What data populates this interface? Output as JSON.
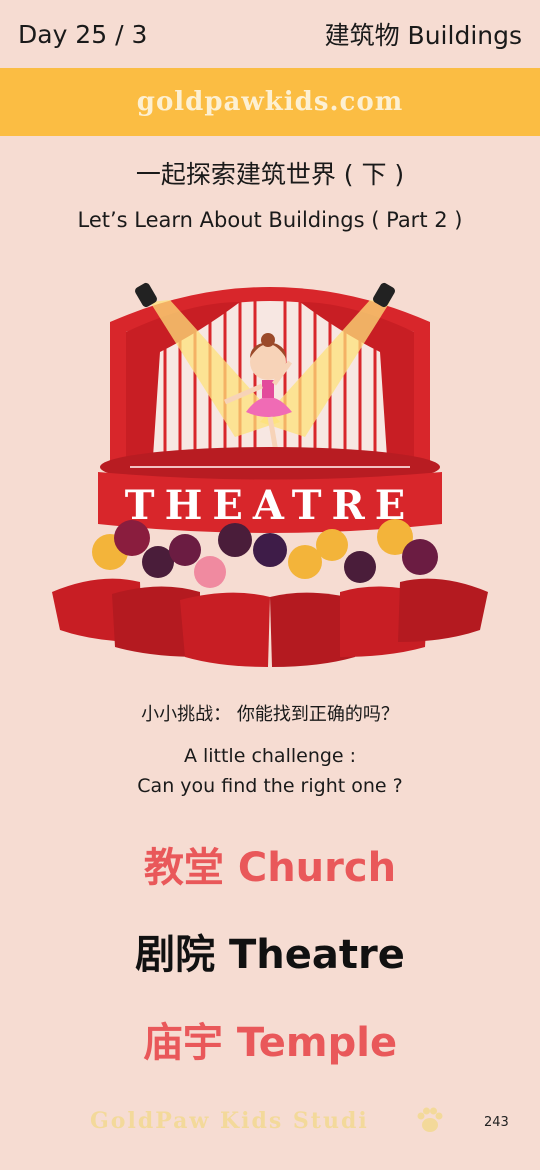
{
  "header": {
    "day": "Day 25 / 3",
    "topic": "建筑物 Buildings"
  },
  "banner": {
    "brand": "goldpawkids.com",
    "color": "#fbbd43"
  },
  "title": {
    "cn": "一起探索建筑世界 ( 下 )",
    "en": "Let’s Learn About Buildings ( Part 2 )"
  },
  "illustration": {
    "sign_text": "THEATRE",
    "stage_color": "#d8262b"
  },
  "challenge": {
    "cn": "小小挑战： 你能找到正确的吗？",
    "en_line1": "A little challenge :",
    "en_line2": "Can you find the right one ?"
  },
  "options": [
    {
      "label": "教堂 Church",
      "color": "#e9585a"
    },
    {
      "label": "剧院 Theatre",
      "color": "#111111"
    },
    {
      "label": "庙宇 Temple",
      "color": "#e9585a"
    }
  ],
  "footer": {
    "brand": "GoldPaw Kids Studi",
    "icon": "paw-icon",
    "page_number": "243"
  }
}
